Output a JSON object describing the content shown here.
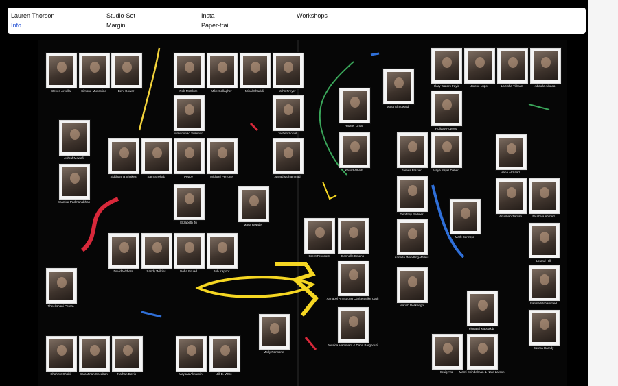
{
  "nav": {
    "links": [
      {
        "label": "Lauren Thorson",
        "active": false
      },
      {
        "label": "Info",
        "active": true
      },
      {
        "label": "Studio-Set",
        "active": false
      },
      {
        "label": "Margin",
        "active": false
      },
      {
        "label": "Insta",
        "active": false
      },
      {
        "label": "Paper-trail",
        "active": false
      },
      {
        "label": "Workshops",
        "active": false
      }
    ]
  },
  "people": [
    "Steven Arcella",
    "Simone Muscolino",
    "Beni Gower",
    "Rob McClure",
    "Mike Gallagher",
    "Mihal Shaduli",
    "John Freyer",
    "Mohammad Suleman",
    "Jochen Sokoll",
    "Ashraf Mowafi",
    "Siddhartha Shakya",
    "Sam Shehab",
    "Peppy",
    "Michael Perrone",
    "Jawad Mohammad",
    "Shankar Padmanabhan",
    "Elizabeth Ju",
    "Maya Rowder",
    "David Withers",
    "Sandy Wilkins",
    "Noha Fouad",
    "Bob Kapoor",
    "Theekshani Perera",
    "Molly Ransone",
    "Shahzur Shakil",
    "Sara Jinan Sheaban",
    "Nathan Davis",
    "Maysaa Almumin",
    "Jill B. Ware",
    "Hilary Waters Fayle",
    "Jolene Lupo",
    "LaKisha Tillman",
    "Abdulla Alsada",
    "Moza Al-Suwaidi",
    "Hadeer Omar",
    "Holiday Powers",
    "Khalid Albaih",
    "James Frazier",
    "Haya Sayel Daher",
    "Hana Al Saadi",
    "Geoffrey Berliner",
    "Anushah Zaman",
    "Elcahiva Ahmed",
    "Mark Bermejo",
    "Greet Provoost",
    "Dennelle Emans",
    "Annette Wendling-Willeis",
    "Leland Hill",
    "Annabel Armstrong Clarke Eelke Cath",
    "Mariah Delikengo",
    "Fatima Mohammed",
    "Fiona El Kaouakibi",
    "Jessica Hammam & Dana Barghouti",
    "Basma Hamdy",
    "Craig Anz",
    "Mami Shindelman & Nate Larson"
  ]
}
